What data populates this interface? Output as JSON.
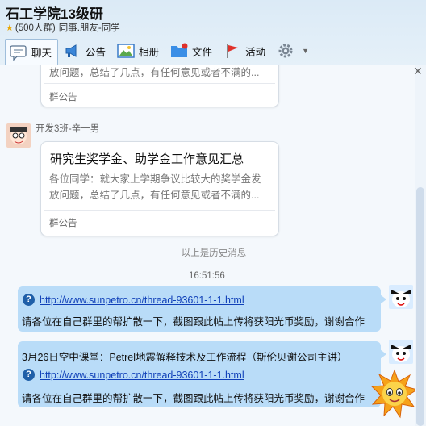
{
  "header": {
    "title": "石工学院13级研",
    "members": "(500人群)",
    "tags": "同事.朋友-同学"
  },
  "toolbar": {
    "items": [
      {
        "label": "聊天",
        "icon": "chat-icon"
      },
      {
        "label": "公告",
        "icon": "megaphone-icon"
      },
      {
        "label": "相册",
        "icon": "photo-icon"
      },
      {
        "label": "文件",
        "icon": "folder-icon"
      },
      {
        "label": "活动",
        "icon": "flag-icon"
      }
    ],
    "settings_icon": "gear-icon"
  },
  "messages": {
    "card1": {
      "body2": "放问题，总结了几点，有任何意见或者不满的...",
      "footer": "群公告"
    },
    "sender_name": "开发3班-辛一男",
    "card2": {
      "title": "研究生奖学金、助学金工作意见汇总",
      "body1": "各位同学：就大家上学期争议比较大的奖学金发",
      "body2": "放问题，总结了几点，有任何意见或者不满的...",
      "footer": "群公告"
    },
    "history_divider": "以上是历史消息",
    "timestamp": "16:51:56",
    "bubble1": {
      "link": "http://www.sunpetro.cn/thread-93601-1-1.html",
      "text": "请各位在自己群里的帮扩散一下，截图跟此帖上传将获阳光币奖励，谢谢合作"
    },
    "bubble2": {
      "line1": "3月26日空中课堂：Petrel地震解释技术及工作流程（斯伦贝谢公司主讲）",
      "link": "http://www.sunpetro.cn/thread-93601-1-1.html",
      "text": "请各位在自己群里的帮扩散一下，截图跟此帖上传将获阳光币奖励，谢谢合作"
    }
  },
  "colors": {
    "bubble": "#b9dcf8",
    "link": "#1040b8",
    "accent": "#1f5fa8"
  }
}
